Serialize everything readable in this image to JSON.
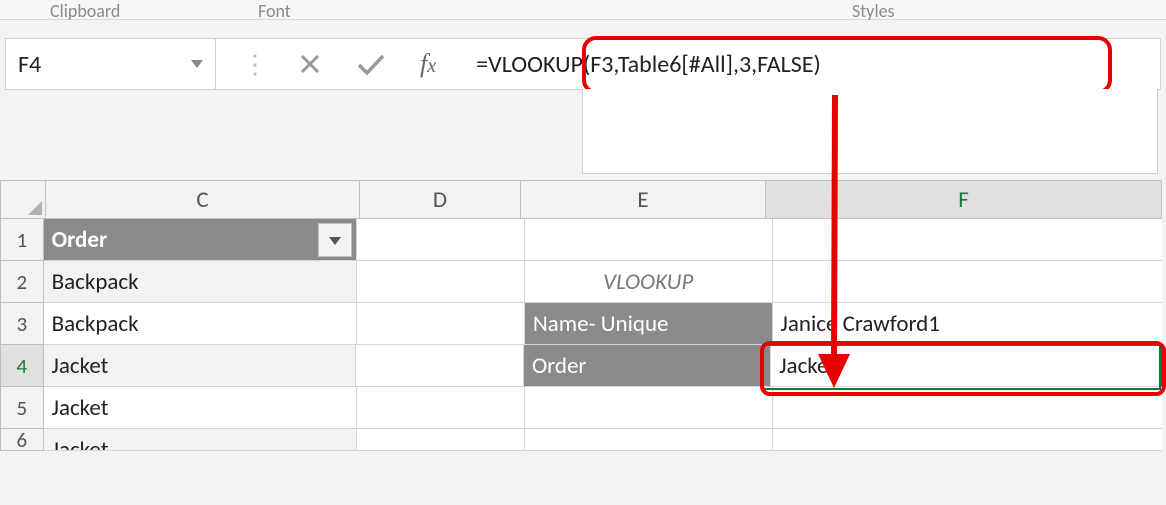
{
  "ribbon": {
    "group_left": "Clipboard",
    "group_mid": "Font",
    "group_right": "Styles"
  },
  "namebox": {
    "value": "F4"
  },
  "formula_bar": {
    "formula": "=VLOOKUP(F3,Table6[#All],3,FALSE)"
  },
  "columns": {
    "C": "C",
    "D": "D",
    "E": "E",
    "F": "F"
  },
  "rows": [
    "1",
    "2",
    "3",
    "4",
    "5",
    "6"
  ],
  "table": {
    "header": "Order",
    "c2": "Backpack",
    "c3": "Backpack",
    "c4": "Jacket",
    "c5": "Jacket",
    "c6": "Jacket"
  },
  "side": {
    "vlookup_title": "VLOOKUP",
    "name_label": "Name- Unique",
    "name_value": "Janice Crawford1",
    "order_label": "Order",
    "order_value": "Jacket"
  }
}
